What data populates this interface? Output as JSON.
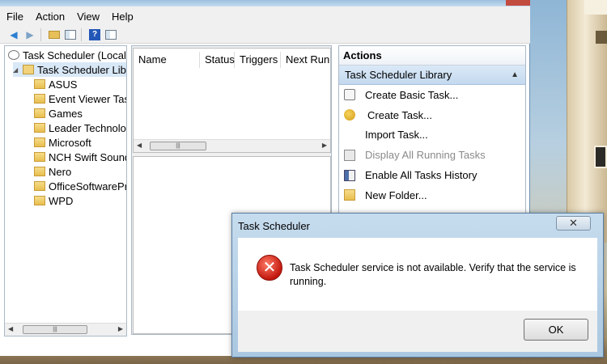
{
  "menu": {
    "items": [
      "File",
      "Action",
      "View",
      "Help"
    ]
  },
  "toolbar": {
    "icons": [
      "back-arrow-icon",
      "forward-arrow-icon",
      "up-folder-icon",
      "show-hide-console-tree-icon",
      "help-icon",
      "show-hide-action-pane-icon"
    ]
  },
  "tree": {
    "root": "Task Scheduler (Local)",
    "library": "Task Scheduler Library",
    "folders": [
      "ASUS",
      "Event Viewer Tasks",
      "Games",
      "Leader Technologies",
      "Microsoft",
      "NCH Swift Sound",
      "Nero",
      "OfficeSoftwareProtectionPlatform",
      "WPD"
    ]
  },
  "list": {
    "columns": [
      "Name",
      "Status",
      "Triggers",
      "Next Run Time"
    ]
  },
  "actions": {
    "title": "Actions",
    "section": "Task Scheduler Library",
    "items": [
      {
        "label": "Create Basic Task...",
        "icon": "create-basic-task-icon",
        "enabled": true
      },
      {
        "label": "Create Task...",
        "icon": "create-task-icon",
        "enabled": true
      },
      {
        "label": "Import Task...",
        "icon": "",
        "enabled": true
      },
      {
        "label": "Display All Running Tasks",
        "icon": "running-tasks-icon",
        "enabled": false
      },
      {
        "label": "Enable All Tasks History",
        "icon": "tasks-history-icon",
        "enabled": true
      },
      {
        "label": "New Folder...",
        "icon": "new-folder-icon",
        "enabled": true
      }
    ]
  },
  "dialog": {
    "title": "Task Scheduler",
    "message": "Task Scheduler service is not available. Verify that the service is running.",
    "ok_label": "OK",
    "icon": "error-icon"
  }
}
